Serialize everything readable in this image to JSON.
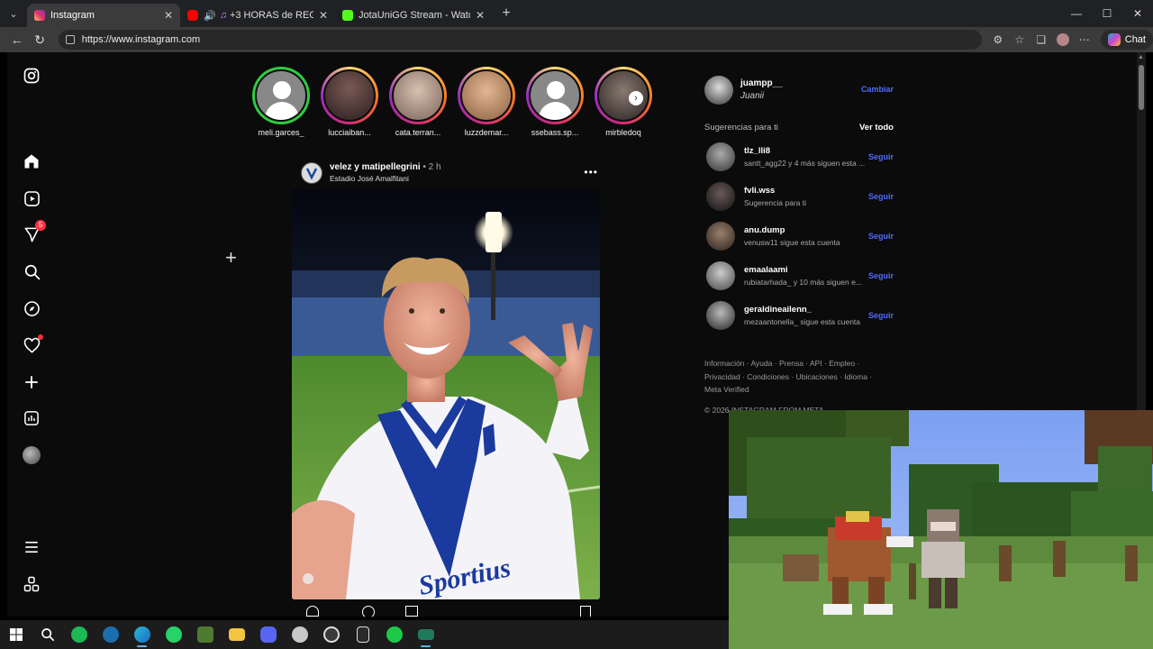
{
  "browser": {
    "tabs": [
      {
        "title": "Instagram",
        "close": "✕",
        "color": "#e1306c",
        "active": true
      },
      {
        "title": "+3 HORAS de REGGAETON",
        "close": "✕",
        "color": "#ff0000",
        "active": false
      },
      {
        "title": "JotaUniGG Stream - Watch Live on",
        "close": "✕",
        "color": "#53fc18",
        "active": false
      }
    ],
    "new_tab": "+",
    "url": "https://www.instagram.com",
    "chat_label": "Chat",
    "window_controls": {
      "minimize": "—",
      "maximize": "☐",
      "close": "✕"
    }
  },
  "nav": {
    "notifications_badge": "5",
    "icons": [
      "instagram-logo-icon",
      "home-icon",
      "reels-icon",
      "messages-icon",
      "search-icon",
      "explore-icon",
      "notifications-icon",
      "create-icon",
      "dashboard-icon",
      "profile-icon",
      "menu-icon",
      "apps-icon"
    ]
  },
  "stories": [
    {
      "name": "meli.garces_",
      "seen": true,
      "avatar": "default"
    },
    {
      "name": "lucciaiban...",
      "seen": false,
      "avatar": "#4a3535"
    },
    {
      "name": "cata.terran...",
      "seen": false,
      "avatar": "#8a7060"
    },
    {
      "name": "luzzdemar...",
      "seen": false,
      "avatar": "#b88a6a"
    },
    {
      "name": "ssebass.sp...",
      "seen": false,
      "avatar": "default"
    },
    {
      "name": "mirbledoq",
      "seen": false,
      "avatar": "#3a3030"
    }
  ],
  "story_next": "›",
  "post": {
    "user": "velez y matipellegrini",
    "time": "• 2 h",
    "location": "Estadio José Amalfitani",
    "more": "•••",
    "image_text": "Sportius"
  },
  "account": {
    "username": "juampp__",
    "name": "Juanii",
    "switch_label": "Cambiar"
  },
  "suggestions": {
    "heading": "Sugerencias para ti",
    "see_all": "Ver todo",
    "items": [
      {
        "username": "tlz_lli8",
        "subtitle": "santt_agg22 y 4 más siguen esta ...",
        "action": "Seguir"
      },
      {
        "username": "fvli.wss",
        "subtitle": "Sugerencia para ti",
        "action": "Seguir"
      },
      {
        "username": "anu.dump",
        "subtitle": "venusw11 sigue esta cuenta",
        "action": "Seguir"
      },
      {
        "username": "emaalaami",
        "subtitle": "rubiatarhada_ y 10 más siguen e...",
        "action": "Seguir"
      },
      {
        "username": "geraldineailenn_",
        "subtitle": "mezaantonella_ sigue esta cuenta",
        "action": "Seguir"
      }
    ]
  },
  "footer": {
    "links_line1": "Información · Ayuda · Prensa · API · Empleo ·",
    "links_line2": "Privacidad · Condiciones · Ubicaciones · Idioma ·",
    "links_line3": "Meta Verified",
    "copyright": "© 2026 INSTAGRAM FROM META"
  },
  "taskbar": {
    "apps": [
      {
        "name": "start-button",
        "color": "#ffffff"
      },
      {
        "name": "search-button",
        "color": "#ffffff"
      },
      {
        "name": "spotify-icon",
        "color": "#1db954"
      },
      {
        "name": "steam-icon",
        "color": "#1b6fae"
      },
      {
        "name": "edge-icon",
        "color": "#2bb6d8"
      },
      {
        "name": "whatsapp-icon",
        "color": "#25d366"
      },
      {
        "name": "minecraft-icon",
        "color": "#4f7a32"
      },
      {
        "name": "file-explorer-icon",
        "color": "#f4c542"
      },
      {
        "name": "discord-icon",
        "color": "#5865f2"
      },
      {
        "name": "game-launcher-icon",
        "color": "#c8c8c8"
      },
      {
        "name": "obs-icon",
        "color": "#3a3a3a"
      },
      {
        "name": "epic-games-icon",
        "color": "#2a2a2a"
      },
      {
        "name": "green-app-icon",
        "color": "#1ec94a"
      },
      {
        "name": "terminal-icon",
        "color": "#1f7a5a"
      }
    ]
  }
}
